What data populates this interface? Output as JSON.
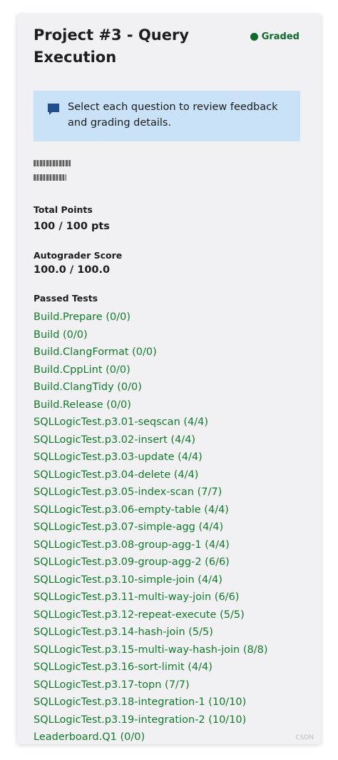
{
  "header": {
    "title": "Project #3 - Query Execution",
    "status": "Graded",
    "status_color": "#0f6b29"
  },
  "notice": {
    "icon": "comment-icon",
    "text": "Select each question to review feedback and grading details."
  },
  "total_points": {
    "label": "Total Points",
    "value": "100 / 100 pts"
  },
  "autograder": {
    "label": "Autograder Score",
    "value": "100.0 / 100.0"
  },
  "passed_tests": {
    "label": "Passed Tests",
    "items": [
      "Build.Prepare (0/0)",
      "Build (0/0)",
      "Build.ClangFormat (0/0)",
      "Build.CppLint (0/0)",
      "Build.ClangTidy (0/0)",
      "Build.Release (0/0)",
      "SQLLogicTest.p3.01-seqscan (4/4)",
      "SQLLogicTest.p3.02-insert (4/4)",
      "SQLLogicTest.p3.03-update (4/4)",
      "SQLLogicTest.p3.04-delete (4/4)",
      "SQLLogicTest.p3.05-index-scan (7/7)",
      "SQLLogicTest.p3.06-empty-table (4/4)",
      "SQLLogicTest.p3.07-simple-agg (4/4)",
      "SQLLogicTest.p3.08-group-agg-1 (4/4)",
      "SQLLogicTest.p3.09-group-agg-2 (6/6)",
      "SQLLogicTest.p3.10-simple-join (4/4)",
      "SQLLogicTest.p3.11-multi-way-join (6/6)",
      "SQLLogicTest.p3.12-repeat-execute (5/5)",
      "SQLLogicTest.p3.14-hash-join (5/5)",
      "SQLLogicTest.p3.15-multi-way-hash-join (8/8)",
      "SQLLogicTest.p3.16-sort-limit (4/4)",
      "SQLLogicTest.p3.17-topn (7/7)",
      "SQLLogicTest.p3.18-integration-1 (10/10)",
      "SQLLogicTest.p3.19-integration-2 (10/10)",
      "Leaderboard.Q1 (0/0)"
    ],
    "link_color": "#137a2c"
  }
}
